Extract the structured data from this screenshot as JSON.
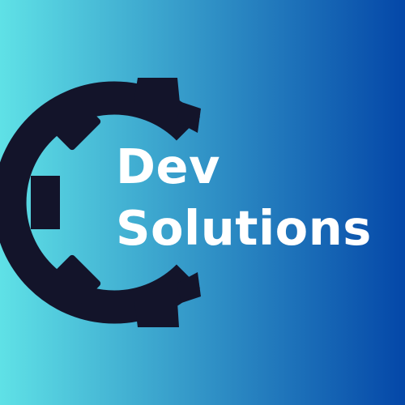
{
  "logo": {
    "line1": "Dev",
    "line2": "Solutions",
    "icon": "gear-icon",
    "colors": {
      "gradient_start": "#5fe1e6",
      "gradient_end": "#0447a8",
      "gear": "#13142a",
      "text": "#ffffff"
    }
  }
}
